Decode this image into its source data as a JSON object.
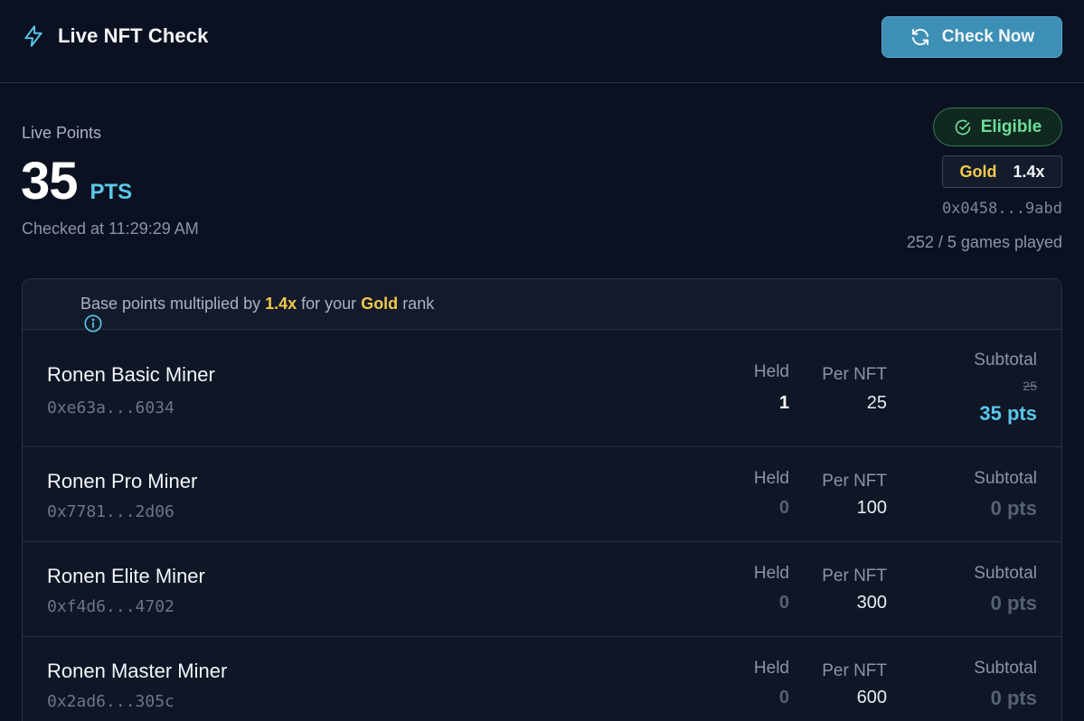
{
  "header": {
    "title": "Live NFT Check",
    "check_button": "Check Now",
    "title_icon": "bolt-icon",
    "button_icon": "refresh-icon"
  },
  "points": {
    "label": "Live Points",
    "value": "35",
    "unit": "PTS",
    "checked_at": "Checked at 11:29:29 AM"
  },
  "status": {
    "eligible": "Eligible",
    "rank": "Gold",
    "multiplier": "1.4x",
    "wallet": "0x0458...9abd",
    "games_played": "252 / 5 games played"
  },
  "info": {
    "prefix": "Base points multiplied by ",
    "multiplier": "1.4x",
    "middle": " for your ",
    "rank": "Gold",
    "suffix": " rank"
  },
  "columns": {
    "held": "Held",
    "per_nft": "Per NFT",
    "subtotal": "Subtotal"
  },
  "nfts": [
    {
      "name": "Ronen Basic Miner",
      "address": "0xe63a...6034",
      "held": "1",
      "per_nft": "25",
      "base_subtotal": "25",
      "subtotal": "35 pts"
    },
    {
      "name": "Ronen Pro Miner",
      "address": "0x7781...2d06",
      "held": "0",
      "per_nft": "100",
      "subtotal": "0 pts"
    },
    {
      "name": "Ronen Elite Miner",
      "address": "0xf4d6...4702",
      "held": "0",
      "per_nft": "300",
      "subtotal": "0 pts"
    },
    {
      "name": "Ronen Master Miner",
      "address": "0x2ad6...305c",
      "held": "0",
      "per_nft": "600",
      "subtotal": "0 pts"
    }
  ],
  "colors": {
    "background": "#0b1121",
    "accent": "#5ac8ea",
    "button": "#3d8fb5",
    "gold": "#f2c94c",
    "eligible": "#6edd9a"
  }
}
